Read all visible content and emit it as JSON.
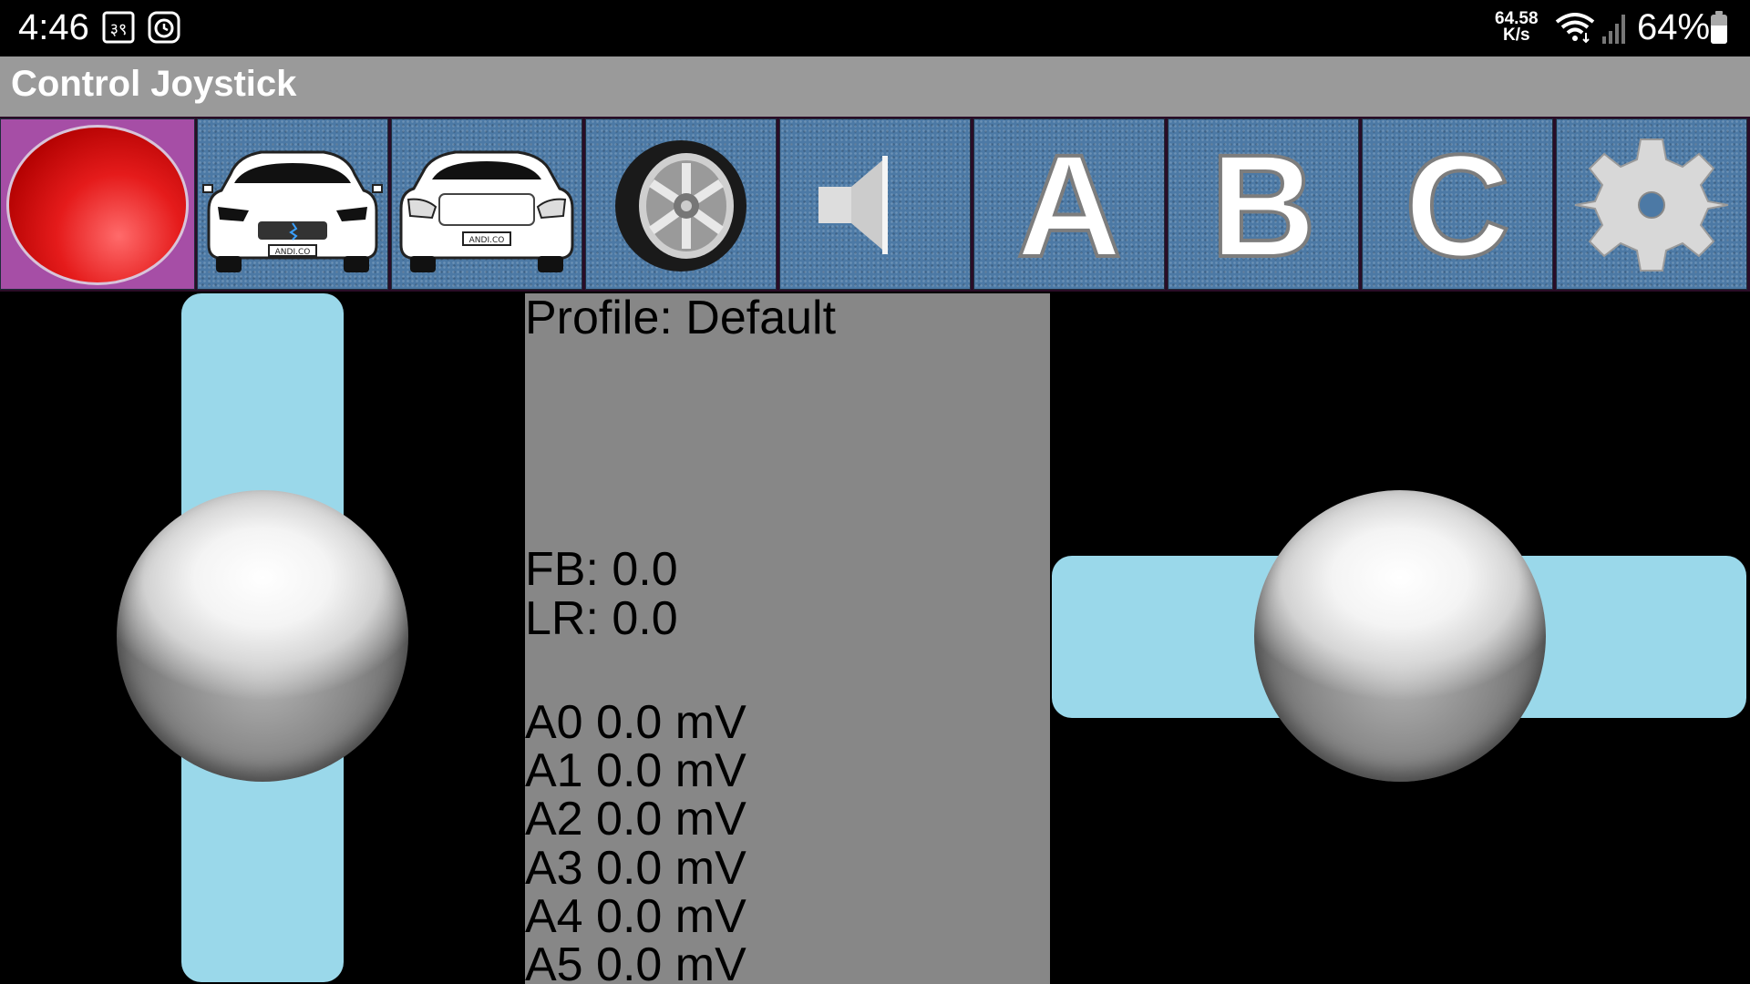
{
  "status_bar": {
    "time": "4:46",
    "notification_icons": [
      "app-notification-icon",
      "clock-app-icon"
    ],
    "net_speed_value": "64.58",
    "net_speed_unit": "K/s",
    "wifi_icon": "wifi-icon",
    "signal_icon": "signal-icon",
    "battery_percent": "64%",
    "battery_level": 0.64
  },
  "app": {
    "title": "Control Joystick"
  },
  "toolbar": {
    "buttons": [
      {
        "id": "record",
        "icon": "record-icon",
        "color": "#e51b1b"
      },
      {
        "id": "car-front",
        "icon": "car-front-icon"
      },
      {
        "id": "car-rear",
        "icon": "car-rear-icon"
      },
      {
        "id": "wheel",
        "icon": "wheel-icon"
      },
      {
        "id": "speaker",
        "icon": "speaker-icon"
      },
      {
        "id": "a",
        "label": "A"
      },
      {
        "id": "b",
        "label": "B"
      },
      {
        "id": "c",
        "label": "C"
      },
      {
        "id": "settings",
        "icon": "gear-icon"
      }
    ],
    "button_background": "#4c79a5",
    "record_background": "#a64ea6"
  },
  "info": {
    "profile": "Profile: Default",
    "fb": "FB: 0.0",
    "lr": "LR: 0.0",
    "analog": [
      "A0 0.0 mV",
      "A1 0.0 mV",
      "A2 0.0 mV",
      "A3 0.0 mV",
      "A4 0.0 mV",
      "A5 0.0 mV"
    ]
  },
  "joysticks": {
    "left": {
      "axis": "vertical",
      "value": 0.0
    },
    "right": {
      "axis": "horizontal",
      "value": 0.0
    },
    "track_color": "#9ad8ea"
  }
}
